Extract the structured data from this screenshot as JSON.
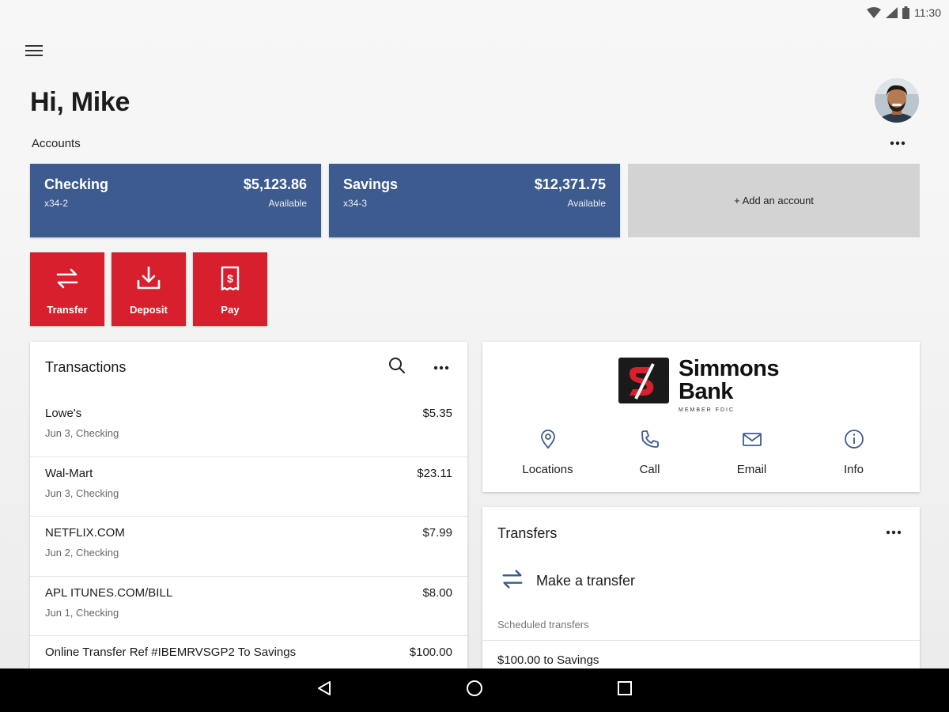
{
  "status_bar": {
    "time": "11:30",
    "icons": [
      "wifi-icon",
      "signal-icon",
      "battery-icon"
    ]
  },
  "header": {
    "menu_icon": "hamburger-menu-icon",
    "greeting": "Hi, Mike",
    "avatar": "user-avatar"
  },
  "accounts": {
    "label": "Accounts",
    "items": [
      {
        "name": "Checking",
        "number": "x34-2",
        "balance": "$5,123.86",
        "balance_label": "Available"
      },
      {
        "name": "Savings",
        "number": "x34-3",
        "balance": "$12,371.75",
        "balance_label": "Available"
      }
    ],
    "add_label": "+ Add an account"
  },
  "actions": [
    {
      "label": "Transfer",
      "icon": "transfer-arrows-icon"
    },
    {
      "label": "Deposit",
      "icon": "deposit-download-icon"
    },
    {
      "label": "Pay",
      "icon": "pay-bill-icon"
    }
  ],
  "transactions": {
    "title": "Transactions",
    "items": [
      {
        "merchant": "Lowe's",
        "meta": "Jun 3, Checking",
        "amount": "$5.35"
      },
      {
        "merchant": "Wal-Mart",
        "meta": "Jun 3, Checking",
        "amount": "$23.11"
      },
      {
        "merchant": "NETFLIX.COM",
        "meta": "Jun 2, Checking",
        "amount": "$7.99"
      },
      {
        "merchant": "APL ITUNES.COM/BILL",
        "meta": "Jun 1, Checking",
        "amount": "$8.00"
      },
      {
        "merchant": "Online Transfer Ref #IBEMRVSGP2 To Savings",
        "meta": "",
        "amount": "$100.00"
      }
    ]
  },
  "bank": {
    "name_line1": "Simmons",
    "name_line2": "Bank",
    "fdic": "MEMBER FDIC",
    "links": [
      {
        "label": "Locations",
        "icon": "location-pin-icon"
      },
      {
        "label": "Call",
        "icon": "phone-icon"
      },
      {
        "label": "Email",
        "icon": "envelope-icon"
      },
      {
        "label": "Info",
        "icon": "info-icon"
      }
    ]
  },
  "transfers": {
    "title": "Transfers",
    "make_label": "Make a transfer",
    "scheduled_label": "Scheduled transfers",
    "scheduled_items": [
      "$100.00 to Savings"
    ]
  },
  "colors": {
    "account_blue": "#3d5b8f",
    "action_red": "#d71f2d",
    "transfer_icon_blue": "#3d5b8f"
  }
}
